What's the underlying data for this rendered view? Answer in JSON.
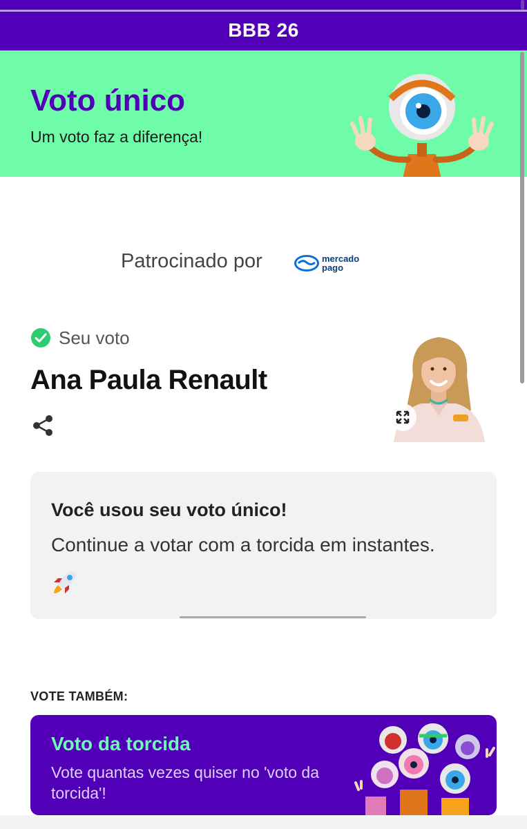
{
  "app": {
    "title": "BBB 26"
  },
  "hero": {
    "title": "Voto único",
    "subtitle": "Um voto faz a diferença!",
    "mascot_icon": "big-brother-eye-mascot"
  },
  "sponsor": {
    "label": "Patrocinado por",
    "logo_line1": "mercado",
    "logo_line2": "pago"
  },
  "vote": {
    "status_label": "Seu voto",
    "candidate_name": "Ana Paula Renault",
    "share_icon": "share-icon",
    "expand_icon": "expand-icon"
  },
  "card": {
    "title": "Você usou seu voto único!",
    "text": "Continue a votar com a torcida em instantes.",
    "emoji_icon": "rocket-icon"
  },
  "also": {
    "label": "VOTE TAMBÉM:"
  },
  "promo": {
    "title": "Voto da torcida",
    "text": "Vote quantas vezes quiser no 'voto da torcida'!"
  },
  "colors": {
    "brand_purple": "#5200b8",
    "hero_green": "#6efca8",
    "promo_title_green": "#6efcb5",
    "check_green": "#2ecc71"
  }
}
